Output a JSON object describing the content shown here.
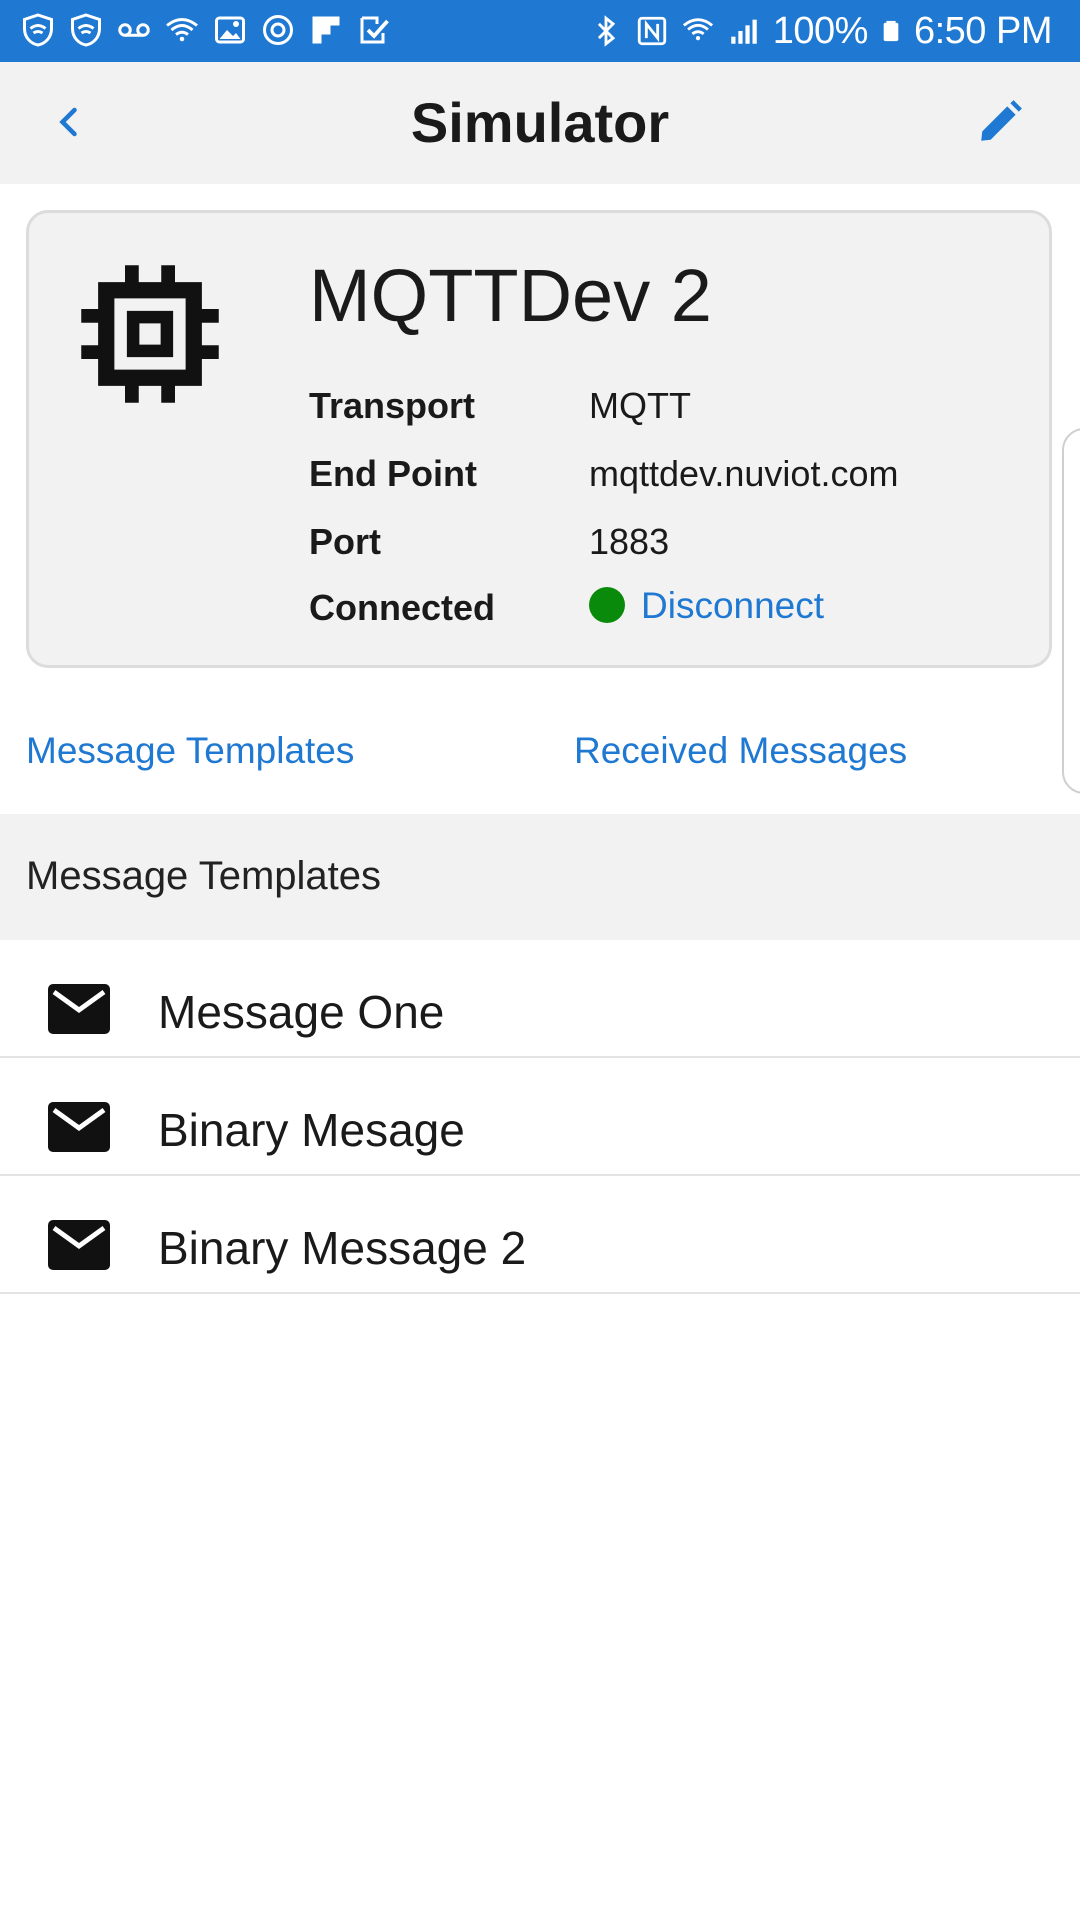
{
  "status_bar": {
    "left_icons": [
      "shield-wifi-icon",
      "shield-wifi-icon",
      "voicemail-icon",
      "wifi-icon",
      "image-icon",
      "sync-icon",
      "flipboard-icon",
      "check-icon"
    ],
    "right_icons": [
      "bluetooth-icon",
      "nfc-icon",
      "wifi-signal-icon",
      "cell-signal-icon",
      "battery-icon"
    ],
    "battery": "100%",
    "time": "6:50 PM"
  },
  "nav": {
    "title": "Simulator",
    "back_icon": "chevron-left-icon",
    "edit_icon": "pencil-icon"
  },
  "device": {
    "icon": "chip-icon",
    "name": "MQTTDev 2",
    "fields": [
      {
        "label": "Transport",
        "value": "MQTT"
      },
      {
        "label": "End Point",
        "value": "mqttdev.nuviot.com"
      },
      {
        "label": "Port",
        "value": "1883"
      },
      {
        "label": "Connected",
        "value": "Disconnect"
      }
    ],
    "connected_status_color": "#0a8a0a"
  },
  "tabs": [
    {
      "label": "Message Templates"
    },
    {
      "label": "Received Messages"
    }
  ],
  "section": {
    "title": "Message Templates"
  },
  "messages": [
    {
      "label": "Message One",
      "icon": "mail-icon"
    },
    {
      "label": "Binary Mesage",
      "icon": "mail-icon"
    },
    {
      "label": "Binary Message 2",
      "icon": "mail-icon"
    }
  ],
  "colors": {
    "accent": "#1f78d1",
    "status_bar": "#1f78d1",
    "nav_bg": "#f2f2f2",
    "connected": "#0a8a0a"
  }
}
